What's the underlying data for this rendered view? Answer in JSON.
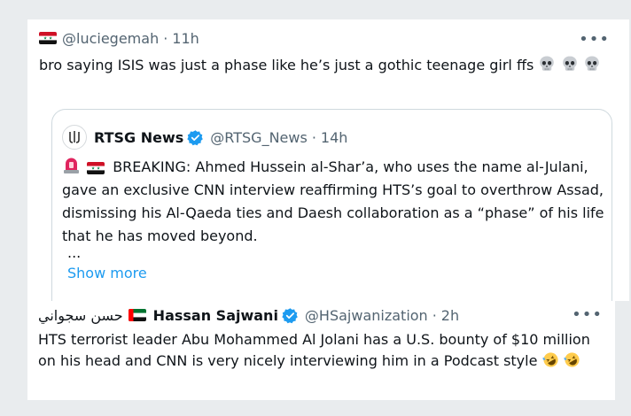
{
  "tweet1": {
    "handle": "@luciegemah",
    "separator": "·",
    "time": "11h",
    "more_icon": "more-horizontal-icon",
    "text": "bro saying ISIS was just a phase like he’s just a gothic teenage girl ffs",
    "flag": "syria-flag",
    "emoji": "skull"
  },
  "quote": {
    "name": "RTSG News",
    "handle": "@RTSG_News",
    "separator": "·",
    "time": "14h",
    "text": "BREAKING: Ahmed Hussein al-Shar’a, who uses the name al-Julani, gave an exclusive CNN interview reaffirming HTS’s goal to overthrow Assad, dismissing his Al-Qaeda ties and Daesh collaboration as a “phase” of his life that he has moved beyond.",
    "ellipsis": "...",
    "show_more": "Show more",
    "emojis": [
      "rotating-light",
      "syria-flag"
    ]
  },
  "tweet2": {
    "arabic_name": "حسن سجواني",
    "name": "Hassan Sajwani",
    "handle": "@HSajwanization",
    "separator": "·",
    "time": "2h",
    "text": "HTS terrorist leader Abu Mohammed Al Jolani has a U.S. bounty of $10 million on his head and CNN is very nicely interviewing him in a Podcast style",
    "flag": "uae-flag",
    "emoji": "rolling-on-floor-laughing"
  },
  "colors": {
    "text": "#0f1419",
    "secondary": "#536471",
    "link": "#1d9bf0",
    "border": "#cfd9de",
    "background": "#e9ecee"
  }
}
